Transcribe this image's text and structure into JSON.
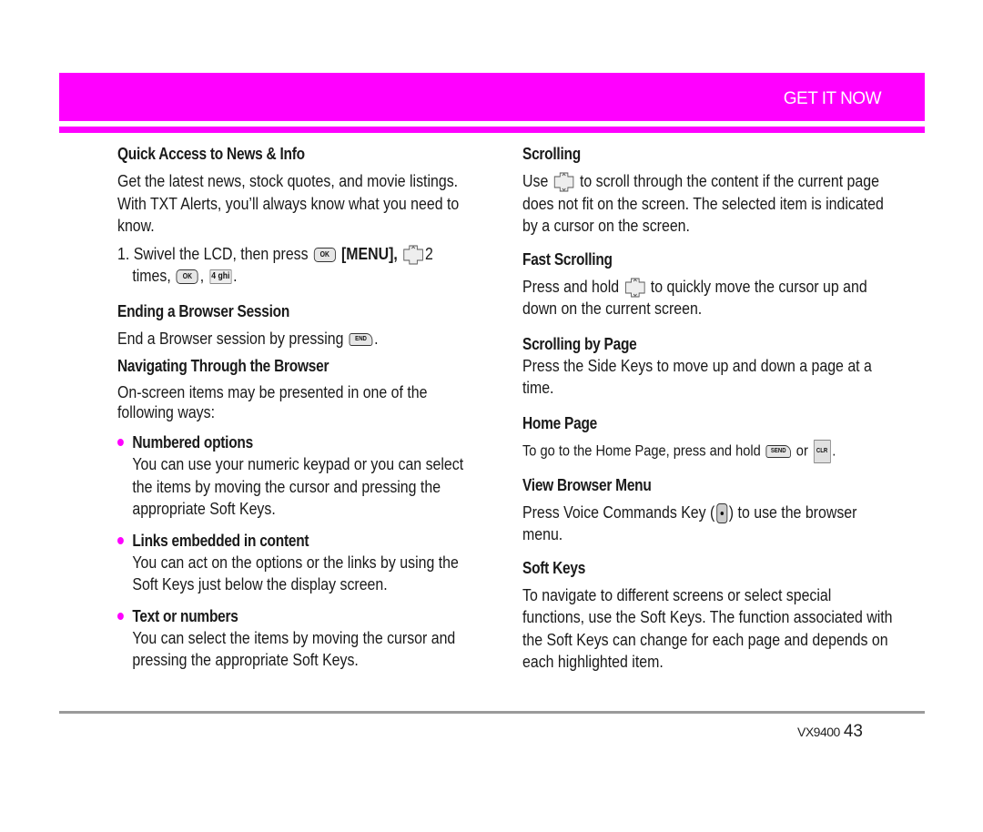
{
  "header": {
    "section_title": "GET IT NOW",
    "accent_color": "#ff00ff"
  },
  "left": {
    "quick_access": {
      "title": "Quick Access to News & Info",
      "body": "Get the latest news, stock quotes, and movie listings. With TXT Alerts, you’ll always know what you need to know.",
      "step_prefix": "1. Swivel the LCD, then press",
      "ok_key": "OK",
      "menu_label": "[MENU],",
      "times_count": "2",
      "times_label": "times,",
      "ok_key2": "OK",
      "comma": ",",
      "four_key": "4 ghi",
      "period": "."
    },
    "ending": {
      "title": "Ending a Browser Session",
      "body": "End a Browser session by pressing",
      "end_key": "END",
      "period": "."
    },
    "navigating": {
      "title": "Navigating Through the Browser",
      "body": "On-screen items may be presented in one of the following ways:"
    },
    "bullets": [
      {
        "title": "Numbered options",
        "body": "You can use your numeric keypad or you can select the items by moving the cursor and pressing the appropriate Soft Keys."
      },
      {
        "title": "Links embedded in content",
        "body": "You can act on the options or the links by using the Soft Keys just below the display screen."
      },
      {
        "title": "Text or numbers",
        "body": "You can select the items by moving the cursor and pressing the appropriate Soft Keys."
      }
    ]
  },
  "right": {
    "scrolling": {
      "title": "Scrolling",
      "pre": "Use",
      "post": "to scroll through the content if the current page does not fit on the screen. The selected item is indicated by a cursor on the screen."
    },
    "fast_scrolling": {
      "title": "Fast Scrolling",
      "pre": "Press and hold",
      "post": "to quickly move the cursor up and down on the current screen."
    },
    "scrolling_by_page": {
      "title": "Scrolling by Page",
      "body": "Press the Side Keys to move up and down a page at a time."
    },
    "home_page": {
      "title": "Home Page",
      "pre": "To go to the Home Page, press and hold",
      "send_key": "SEND",
      "or": "or",
      "clr_key": "CLR",
      "period": "."
    },
    "view_browser_menu": {
      "title": "View Browser Menu",
      "pre": "Press Voice Commands Key (",
      "post": ") to use the browser menu."
    },
    "soft_keys": {
      "title": "Soft Keys",
      "body": "To navigate to different screens or select special functions, use the Soft Keys. The function associated with the Soft Keys can change for each page and depends on each highlighted item."
    }
  },
  "footer": {
    "model": "VX9400",
    "page_number": "43"
  }
}
